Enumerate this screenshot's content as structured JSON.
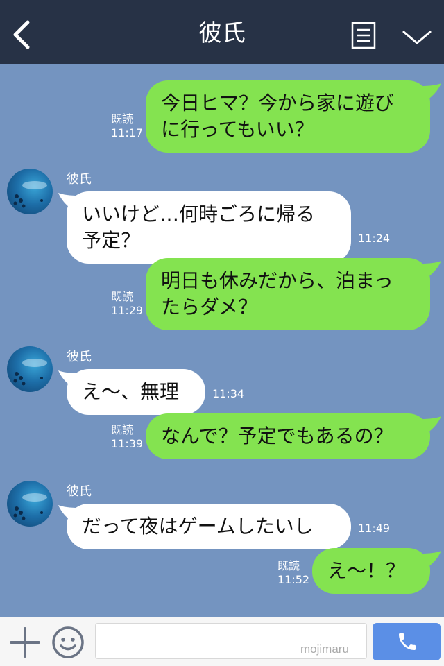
{
  "header": {
    "title": "彼氏",
    "back_icon": "chevron-left-icon",
    "menu_icon": "menu-list-icon",
    "collapse_icon": "chevron-down-icon"
  },
  "messages": [
    {
      "side": "right",
      "text": "今日ヒマ？今から家に遊び\nに行ってもいい？",
      "read": "既読",
      "time": "11:17"
    },
    {
      "side": "left",
      "sender": "彼氏",
      "text": "いいけど…何時ごろに帰る\n予定？",
      "time": "11:24"
    },
    {
      "side": "right",
      "text": "明日も休みだから、泊まっ\nたらダメ？",
      "read": "既読",
      "time": "11:29"
    },
    {
      "side": "left",
      "sender": "彼氏",
      "text": "え～、無理",
      "time": "11:34"
    },
    {
      "side": "right",
      "text": "なんで？予定でもあるの？",
      "read": "既読",
      "time": "11:39"
    },
    {
      "side": "left",
      "sender": "彼氏",
      "text": "だって夜はゲームしたいし",
      "time": "11:49"
    },
    {
      "side": "right",
      "text": "え～！？",
      "read": "既読",
      "time": "11:52"
    }
  ],
  "composer": {
    "value": "",
    "placeholder": "",
    "watermark": "mojimaru"
  },
  "colors": {
    "header_bg": "#273246",
    "chat_bg": "#7494c0",
    "bubble_sent": "#84e350",
    "bubble_received": "#ffffff",
    "call_button": "#5b8fe6"
  }
}
